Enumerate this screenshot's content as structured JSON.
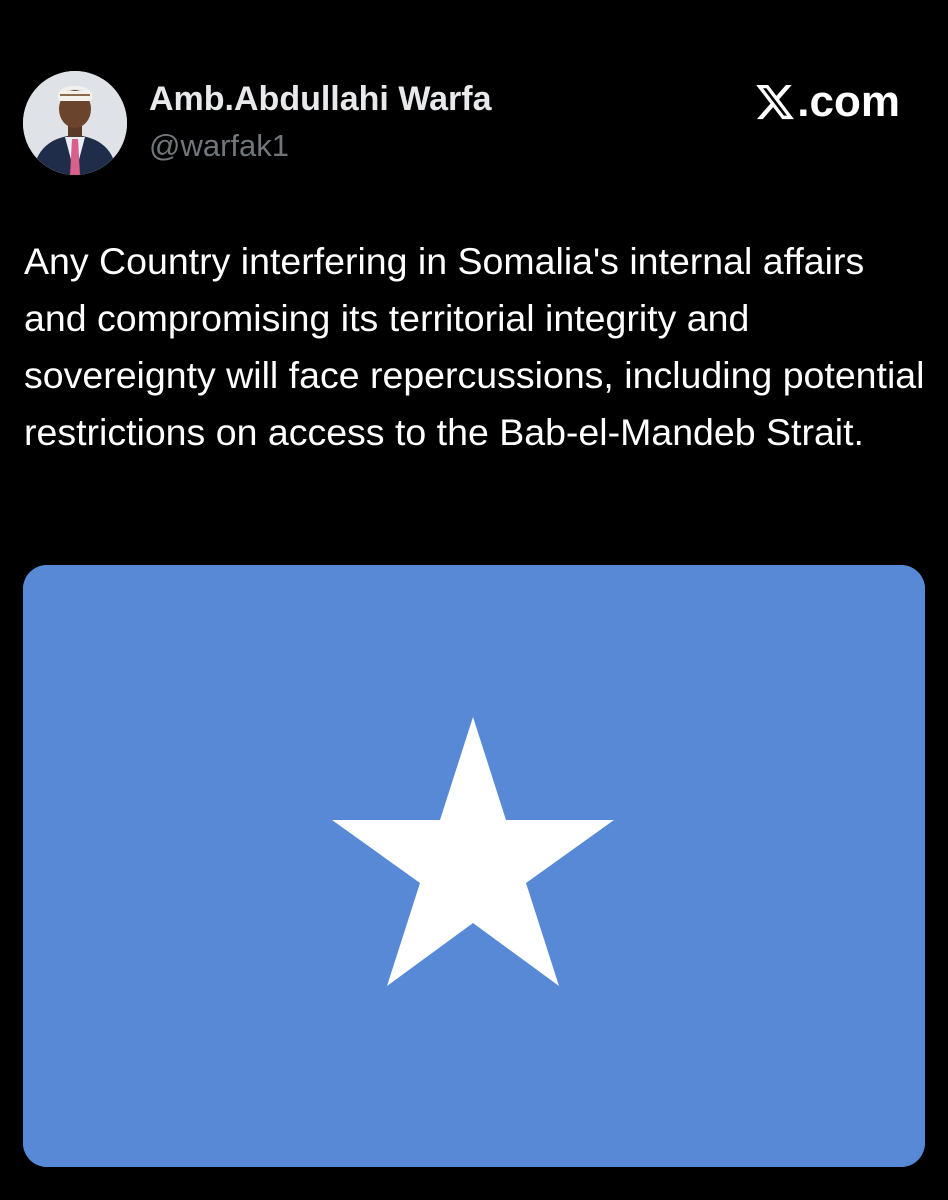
{
  "author": {
    "display_name": "Amb.Abdullahi Warfa",
    "handle": "@warfak1",
    "avatar_icon": "profile-photo"
  },
  "source": {
    "label": ".com",
    "logo_icon": "x-logo-icon",
    "brand_color": "#ffffff"
  },
  "tweet": {
    "text": "Any Country interfering in Somalia's internal affairs and compromising its territorial integrity and sovereignty will face repercussions, including potential restrictions on access to the Bab-el-Mandeb Strait."
  },
  "media": {
    "image_icon": "somalia-flag-image",
    "flag_color": "#5889d6",
    "star_color": "#ffffff"
  },
  "colors": {
    "background": "#000000",
    "primary_text": "#ffffff",
    "secondary_text": "#71767b"
  }
}
